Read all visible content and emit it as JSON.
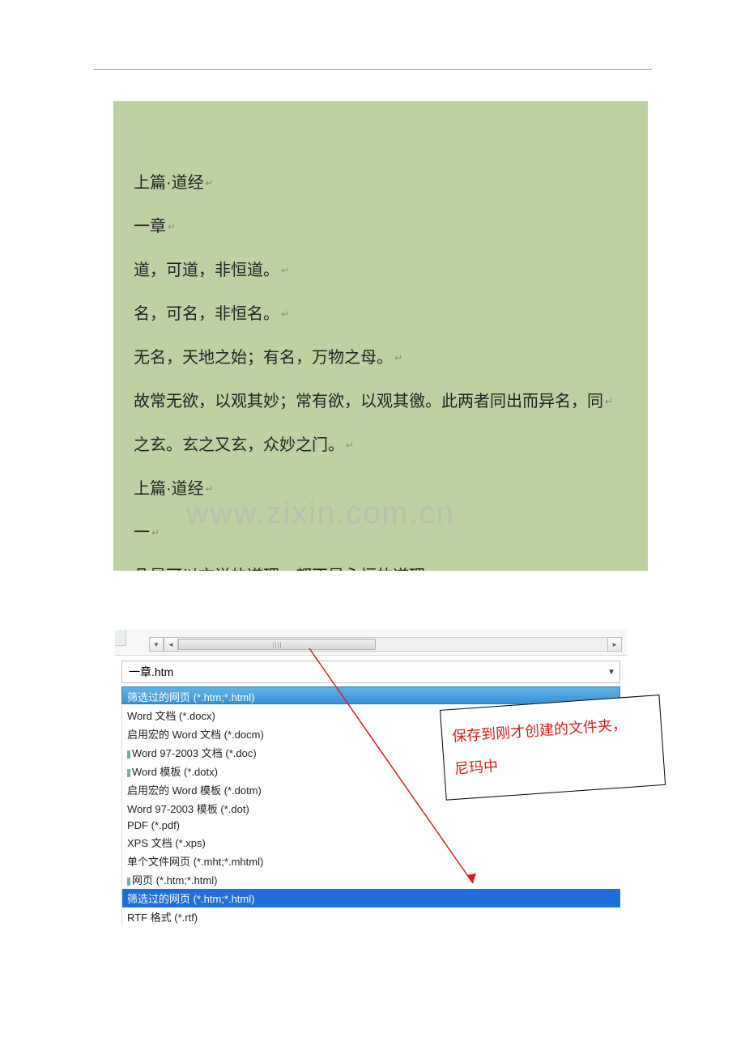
{
  "document": {
    "lines": [
      "上篇·道经",
      "一章",
      "道，可道，非恒道。",
      "名，可名，非恒名。",
      "无名，天地之始；有名，万物之母。",
      "故常无欲，以观其妙；常有欲，以观其徼。此两者同出而异名，同",
      "之玄。玄之又玄，众妙之门。",
      "上篇·道经",
      "一",
      "凡是可以言说的道理，都不是永恒的道理。"
    ]
  },
  "watermark": "www.zixin.com.cn",
  "save_dialog": {
    "filename": "一章.htm",
    "selected_type": "筛选过的网页 (*.htm;*.html)",
    "types": [
      {
        "label": "Word 文档 (*.docx)",
        "hl": false,
        "tick": false
      },
      {
        "label": "启用宏的 Word 文档 (*.docm)",
        "hl": false,
        "tick": false
      },
      {
        "label": "Word 97-2003 文档 (*.doc)",
        "hl": false,
        "tick": true
      },
      {
        "label": "Word 模板 (*.dotx)",
        "hl": false,
        "tick": true
      },
      {
        "label": "启用宏的 Word 模板 (*.dotm)",
        "hl": false,
        "tick": false
      },
      {
        "label": "Word 97-2003 模板 (*.dot)",
        "hl": false,
        "tick": false
      },
      {
        "label": "PDF (*.pdf)",
        "hl": false,
        "tick": false
      },
      {
        "label": "XPS 文档 (*.xps)",
        "hl": false,
        "tick": false
      },
      {
        "label": "单个文件网页 (*.mht;*.mhtml)",
        "hl": false,
        "tick": false
      },
      {
        "label": "网页 (*.htm;*.html)",
        "hl": false,
        "tick": true
      },
      {
        "label": "筛选过的网页 (*.htm;*.html)",
        "hl": true,
        "tick": false
      },
      {
        "label": "RTF 格式 (*.rtf)",
        "hl": false,
        "tick": false
      }
    ]
  },
  "callout": {
    "line1": "保存到刚才创建的文件夹，",
    "line2": "尼玛中"
  }
}
